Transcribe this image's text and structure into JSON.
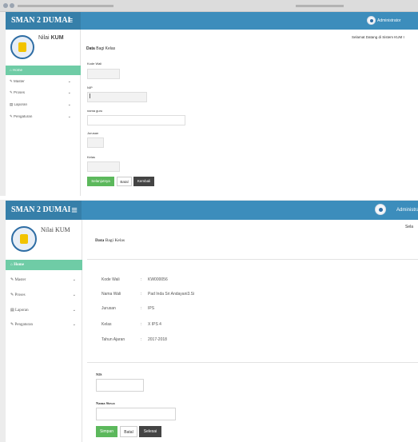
{
  "panel1": {
    "brand": "SMAN 2 DUMAI",
    "app_title_plain": "Nilai",
    "app_title_bold": "KUM",
    "admin_label": "Administrator",
    "welcome": "Selamat Datang di Sistem KUM I",
    "menu": [
      {
        "icon": "⌂",
        "label": "Home"
      },
      {
        "icon": "✎",
        "label": "Master",
        "chevron": "⌄"
      },
      {
        "icon": "✎",
        "label": "Proses",
        "chevron": "⌄"
      },
      {
        "icon": "▤",
        "label": "Laporan",
        "chevron": "⌄"
      },
      {
        "icon": "✎",
        "label": "Pengaturan",
        "chevron": "⌄"
      }
    ],
    "section_title_bold": "Data",
    "section_title_rest": "Bagi Kelas",
    "fields": {
      "kode_wali": "Kode Wali",
      "nip": "NIP",
      "nama_guru": "nama guru",
      "jurusan": "Jurusan",
      "kelas": "Kelas"
    },
    "buttons": {
      "next": "Selanjutnya",
      "cancel": "Batal",
      "back": "Kembali"
    },
    "colors": {
      "topbar": "#3c8dbc",
      "active_menu": "#6fcca6",
      "primary_button": "#5cb85c",
      "dark_button": "#444444"
    }
  },
  "panel2": {
    "brand": "SMAN 2 DUMAI",
    "app_title": "Nilai KUM",
    "admin_label": "Administrator",
    "welcome_partial": "Sela",
    "menu": [
      {
        "icon": "⌂",
        "label": "Home"
      },
      {
        "icon": "✎",
        "label": "Master",
        "chevron": "⌄"
      },
      {
        "icon": "✎",
        "label": "Proses",
        "chevron": "⌄"
      },
      {
        "icon": "▤",
        "label": "Laporan",
        "chevron": "⌄"
      },
      {
        "icon": "✎",
        "label": "Pengaturan",
        "chevron": "⌄"
      }
    ],
    "section_title_bold": "Data",
    "section_title_rest": "Bagi Kelas",
    "info": [
      {
        "label": "Kode Wali",
        "value": "KW000056"
      },
      {
        "label": "Nama Wali",
        "value": "Pad Inda Sri Andayani3.Si"
      },
      {
        "label": "Jurusan",
        "value": "IPS"
      },
      {
        "label": "Kelas",
        "value": "X IPS 4"
      },
      {
        "label": "Tahun Ajaran",
        "value": "2017-2018"
      }
    ],
    "separator": ":",
    "fields": {
      "nis": "NIS",
      "nama_siswa": "Nama Siswa"
    },
    "buttons": {
      "save": "Simpan",
      "cancel": "Batal",
      "finish": "Selesai"
    }
  }
}
